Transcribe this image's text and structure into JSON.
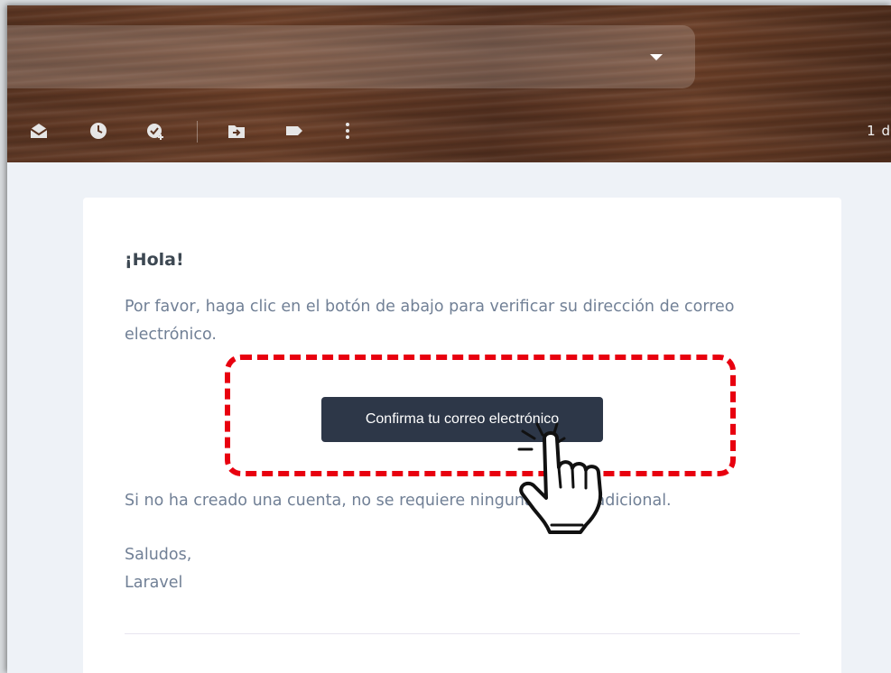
{
  "header": {
    "toolbar": {
      "icons": [
        "mark-as-read-icon",
        "snooze-clock-icon",
        "add-task-icon",
        "move-to-icon",
        "label-icon",
        "more-options-icon"
      ],
      "date_label": "1 d"
    }
  },
  "email": {
    "greeting": "¡Hola!",
    "intro": "Por favor, haga clic en el botón de abajo para verificar su dirección de correo electrónico.",
    "button_label": "Confirma tu correo electrónico",
    "notice": "Si no ha creado una cuenta, no se requiere ninguna acción adicional.",
    "salutation": "Saludos,",
    "signature": "Laravel"
  },
  "colors": {
    "button_bg": "#2d3748",
    "text": "#718096",
    "heading": "#3d4852",
    "highlight": "#e8000f"
  }
}
